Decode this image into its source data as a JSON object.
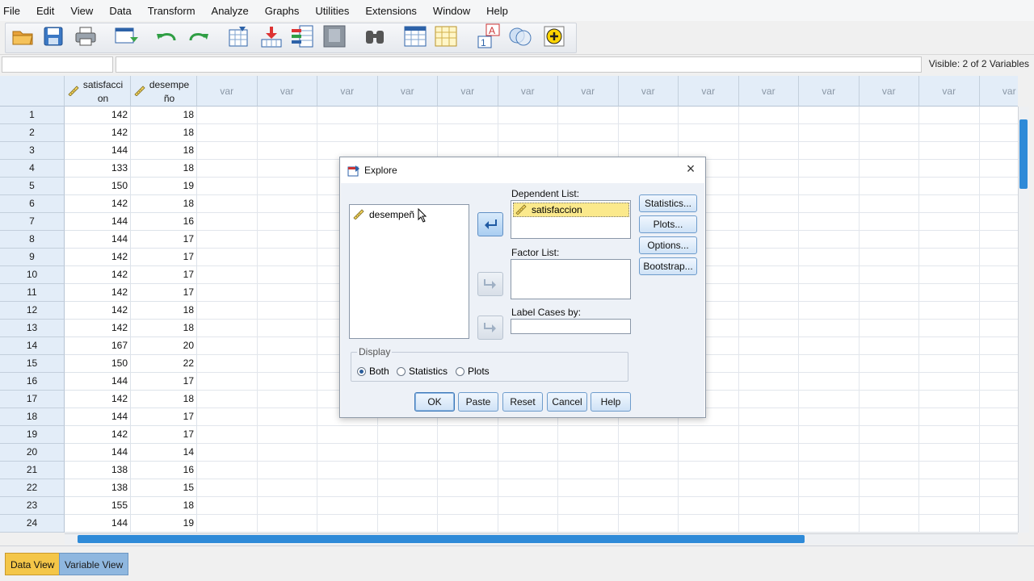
{
  "menu": [
    "File",
    "Edit",
    "View",
    "Data",
    "Transform",
    "Analyze",
    "Graphs",
    "Utilities",
    "Extensions",
    "Window",
    "Help"
  ],
  "toolbar_icons": [
    "open-folder-icon",
    "save-icon",
    "print-icon",
    "recall-dialog-icon",
    "undo-icon",
    "redo-icon",
    "goto-case-icon",
    "goto-variable-icon",
    "variables-icon",
    "run-descriptive-icon",
    "find-icon",
    "insert-cases-icon",
    "insert-variable-icon",
    "value-labels-icon",
    "use-sets-icon",
    "add-icon"
  ],
  "info": {
    "visible": "Visible: 2 of 2 Variables"
  },
  "grid": {
    "var1_line1": "satisfacci",
    "var1_line2": "on",
    "var2_line1": "desempe",
    "var2_line2": "ño",
    "empty_header": "var",
    "rows": [
      [
        "1",
        "142",
        "18"
      ],
      [
        "2",
        "142",
        "18"
      ],
      [
        "3",
        "144",
        "18"
      ],
      [
        "4",
        "133",
        "18"
      ],
      [
        "5",
        "150",
        "19"
      ],
      [
        "6",
        "142",
        "18"
      ],
      [
        "7",
        "144",
        "16"
      ],
      [
        "8",
        "144",
        "17"
      ],
      [
        "9",
        "142",
        "17"
      ],
      [
        "10",
        "142",
        "17"
      ],
      [
        "11",
        "142",
        "17"
      ],
      [
        "12",
        "142",
        "18"
      ],
      [
        "13",
        "142",
        "18"
      ],
      [
        "14",
        "167",
        "20"
      ],
      [
        "15",
        "150",
        "22"
      ],
      [
        "16",
        "144",
        "17"
      ],
      [
        "17",
        "142",
        "18"
      ],
      [
        "18",
        "144",
        "17"
      ],
      [
        "19",
        "142",
        "17"
      ],
      [
        "20",
        "144",
        "14"
      ],
      [
        "21",
        "138",
        "16"
      ],
      [
        "22",
        "138",
        "15"
      ],
      [
        "23",
        "155",
        "18"
      ],
      [
        "24",
        "144",
        "19"
      ]
    ]
  },
  "tabs": {
    "data_view": "Data View",
    "variable_view": "Variable View"
  },
  "dialog": {
    "title": "Explore",
    "source_item": "desempeñ",
    "dependent_label": "Dependent List:",
    "dependent_item": "satisfaccion",
    "factor_label": "Factor List:",
    "label_cases": "Label Cases by:",
    "side_buttons": [
      "Statistics...",
      "Plots...",
      "Options...",
      "Bootstrap..."
    ],
    "display_legend": "Display",
    "radios": [
      "Both",
      "Statistics",
      "Plots"
    ],
    "bottom_buttons": [
      "OK",
      "Paste",
      "Reset",
      "Cancel",
      "Help"
    ]
  },
  "colors": {
    "accent_blue": "#2e8ad8",
    "header_bg": "#e3edf8",
    "tab_active": "#f4c648",
    "selection": "#fbe98c"
  }
}
